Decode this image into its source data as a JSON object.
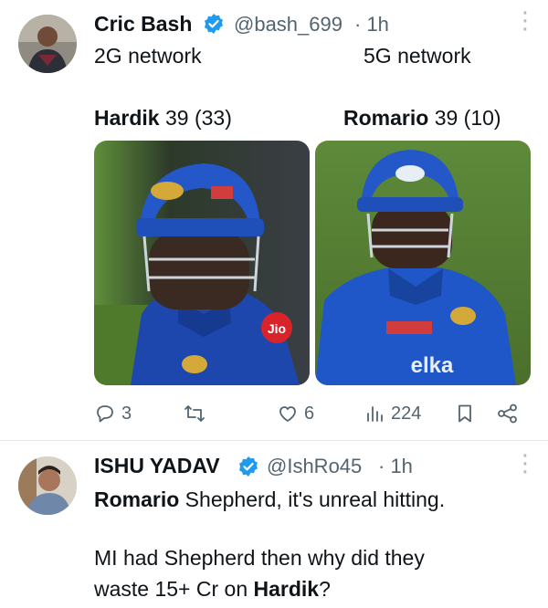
{
  "tweet1": {
    "author_name": "Cric Bash",
    "handle": "@bash_699",
    "time": "· 1h",
    "line1_left": "2G network",
    "line1_right": "5G network",
    "left_player": "Hardik",
    "left_score": "39 (33)",
    "right_player": "Romario",
    "right_score": "39 (10)",
    "left_image_caption": "Jio",
    "right_image_caption": "elka",
    "replies": "3",
    "likes": "6",
    "views": "224"
  },
  "tweet2": {
    "author_name": "ISHU YADAV",
    "handle": "@IshRo45",
    "time": "· 1h",
    "line1_bold": "Romario",
    "line1_rest": " Shepherd, it's unreal hitting.",
    "line2": "MI had Shepherd then why did they",
    "line3_start": "waste 15+ Cr on ",
    "line3_bold": "Hardik",
    "line3_end": "?"
  },
  "colors": {
    "verified": "#1d9bf0",
    "mi_blue": "#1f4fb8",
    "muted": "#536471"
  },
  "icons": [
    "verified-badge-icon",
    "more-icon",
    "reply-icon",
    "retweet-icon",
    "like-icon",
    "views-icon",
    "bookmark-icon",
    "share-icon"
  ]
}
